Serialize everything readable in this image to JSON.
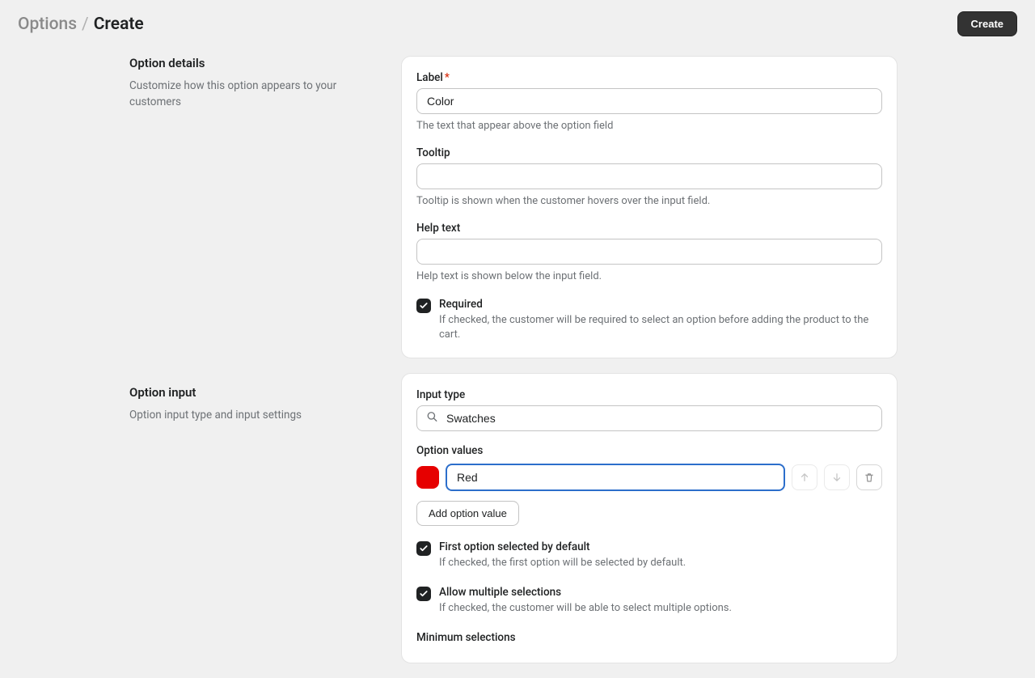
{
  "breadcrumb": {
    "parent": "Options",
    "current": "Create"
  },
  "header": {
    "create_button": "Create"
  },
  "sections": {
    "details": {
      "title": "Option details",
      "desc": "Customize how this option appears to your customers"
    },
    "input": {
      "title": "Option input",
      "desc": "Option input type and input settings"
    }
  },
  "fields": {
    "label": {
      "label": "Label",
      "value": "Color",
      "help": "The text that appear above the option field"
    },
    "tooltip": {
      "label": "Tooltip",
      "value": "",
      "help": "Tooltip is shown when the customer hovers over the input field."
    },
    "helptext": {
      "label": "Help text",
      "value": "",
      "help": "Help text is shown below the input field."
    },
    "required": {
      "label": "Required",
      "help": "If checked, the customer will be required to select an option before adding the product to the cart."
    },
    "input_type": {
      "label": "Input type",
      "value": "Swatches"
    },
    "option_values": {
      "label": "Option values",
      "items": [
        {
          "color": "#e60000",
          "name": "Red"
        }
      ],
      "add_button": "Add option value"
    },
    "first_selected": {
      "label": "First option selected by default",
      "help": "If checked, the first option will be selected by default."
    },
    "allow_multiple": {
      "label": "Allow multiple selections",
      "help": "If checked, the customer will be able to select multiple options."
    },
    "min_selections": {
      "label": "Minimum selections"
    }
  }
}
